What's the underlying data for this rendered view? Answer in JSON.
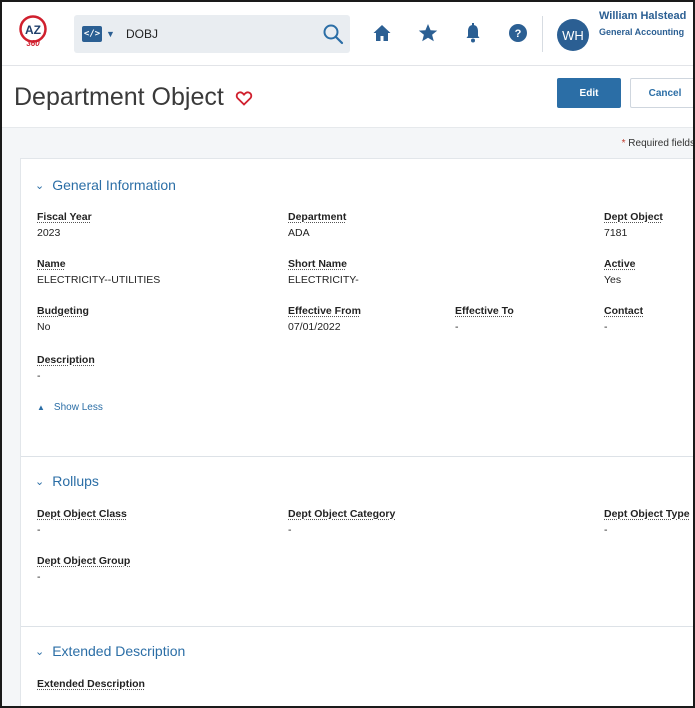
{
  "header": {
    "logo_text": "AZ360",
    "search": {
      "value": "DOBJ",
      "placeholder": ""
    },
    "user": {
      "initials": "WH",
      "name": "William Halstead",
      "role": "General Accounting"
    }
  },
  "page": {
    "title": "Department Object",
    "edit_label": "Edit",
    "cancel_label": "Cancel"
  },
  "required_note": {
    "star": "*",
    "text": " Required fields"
  },
  "general": {
    "title": "General Information",
    "fields": {
      "fiscal_year": {
        "label": "Fiscal Year",
        "value": "2023"
      },
      "department": {
        "label": "Department",
        "value": "ADA"
      },
      "dept_object": {
        "label": "Dept Object",
        "value": "7181"
      },
      "name": {
        "label": "Name",
        "value": "ELECTRICITY--UTILITIES"
      },
      "short_name": {
        "label": "Short Name",
        "value": "ELECTRICITY-"
      },
      "active": {
        "label": "Active",
        "value": "Yes"
      },
      "budgeting": {
        "label": "Budgeting",
        "value": "No"
      },
      "effective_from": {
        "label": "Effective From",
        "value": "07/01/2022"
      },
      "effective_to": {
        "label": "Effective To",
        "value": "-"
      },
      "contact": {
        "label": "Contact",
        "value": "-"
      },
      "description": {
        "label": "Description",
        "value": "-"
      }
    },
    "show_less": "Show Less"
  },
  "rollups": {
    "title": "Rollups",
    "fields": {
      "class": {
        "label": "Dept Object Class",
        "value": "-"
      },
      "category": {
        "label": "Dept Object Category",
        "value": "-"
      },
      "type": {
        "label": "Dept Object Type",
        "value": "-"
      },
      "group": {
        "label": "Dept Object Group",
        "value": "-"
      }
    }
  },
  "extended": {
    "title": "Extended Description",
    "fields": {
      "ext_desc": {
        "label": "Extended Description"
      }
    }
  },
  "colors": {
    "accent": "#2b6ea6",
    "brand": "#2b5f93",
    "logo_red": "#d0202e",
    "star": "#c0392b"
  },
  "icons": [
    "logo-icon",
    "code-icon",
    "search-icon",
    "home-icon",
    "star-icon",
    "bell-icon",
    "help-icon",
    "heart-icon",
    "chevron-down-icon",
    "triangle-up-icon"
  ]
}
